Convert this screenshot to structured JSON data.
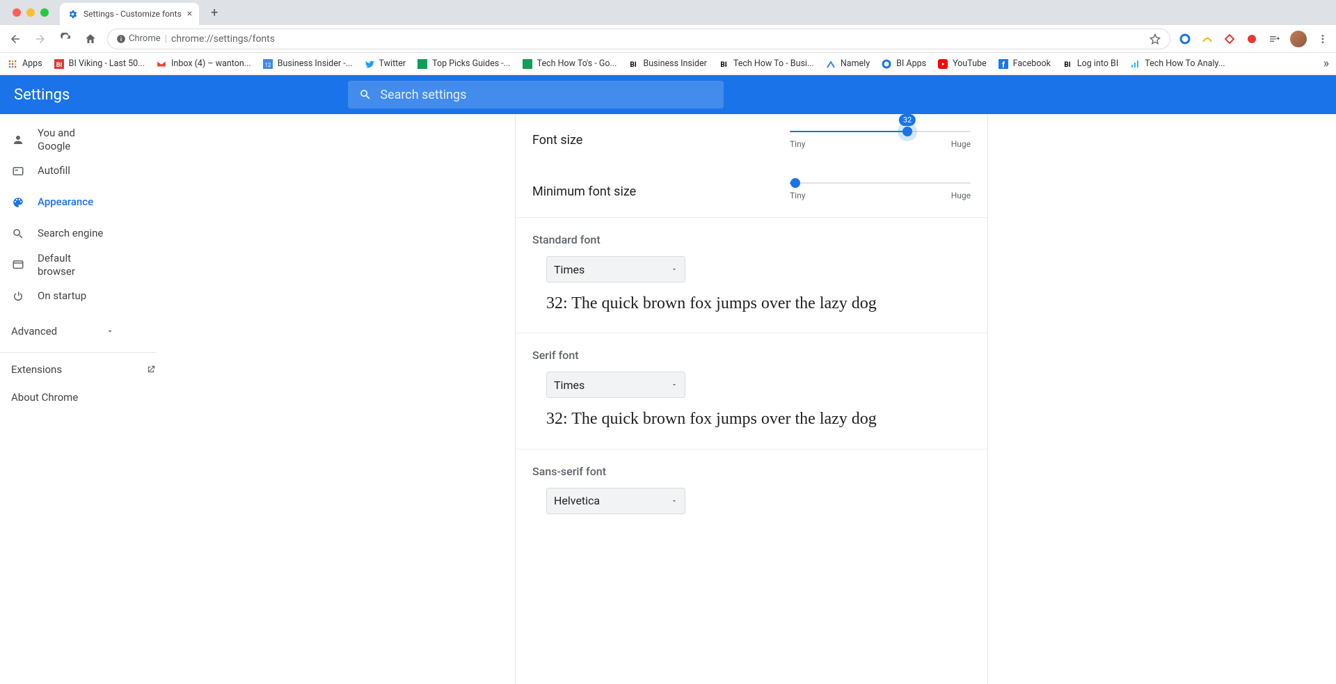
{
  "tab": {
    "title": "Settings - Customize fonts"
  },
  "omnibox": {
    "host": "Chrome",
    "path": "chrome://settings/fonts"
  },
  "bookmarks": [
    "Apps",
    "BI Viking - Last 50...",
    "Inbox (4) – wanton...",
    "Business Insider -...",
    "Twitter",
    "Top Picks Guides -...",
    "Tech How To's - Go...",
    "Business Insider",
    "Tech How To - Busi...",
    "Namely",
    "BI Apps",
    "YouTube",
    "Facebook",
    "Log into BI",
    "Tech How To Analy..."
  ],
  "header": {
    "title": "Settings",
    "search_placeholder": "Search settings"
  },
  "nav": {
    "items": [
      {
        "label": "You and Google"
      },
      {
        "label": "Autofill"
      },
      {
        "label": "Appearance"
      },
      {
        "label": "Search engine"
      },
      {
        "label": "Default browser"
      },
      {
        "label": "On startup"
      }
    ],
    "advanced": "Advanced",
    "extensions": "Extensions",
    "about": "About Chrome"
  },
  "fonts": {
    "font_size_label": "Font size",
    "font_size_value": "32",
    "font_size_pct": 65,
    "min_font_label": "Minimum font size",
    "min_font_pct": 3,
    "tiny": "Tiny",
    "huge": "Huge",
    "standard": {
      "title": "Standard font",
      "value": "Times",
      "preview": "32: The quick brown fox jumps over the lazy dog"
    },
    "serif": {
      "title": "Serif font",
      "value": "Times",
      "preview": "32: The quick brown fox jumps over the lazy dog"
    },
    "sans": {
      "title": "Sans-serif font",
      "value": "Helvetica"
    }
  }
}
